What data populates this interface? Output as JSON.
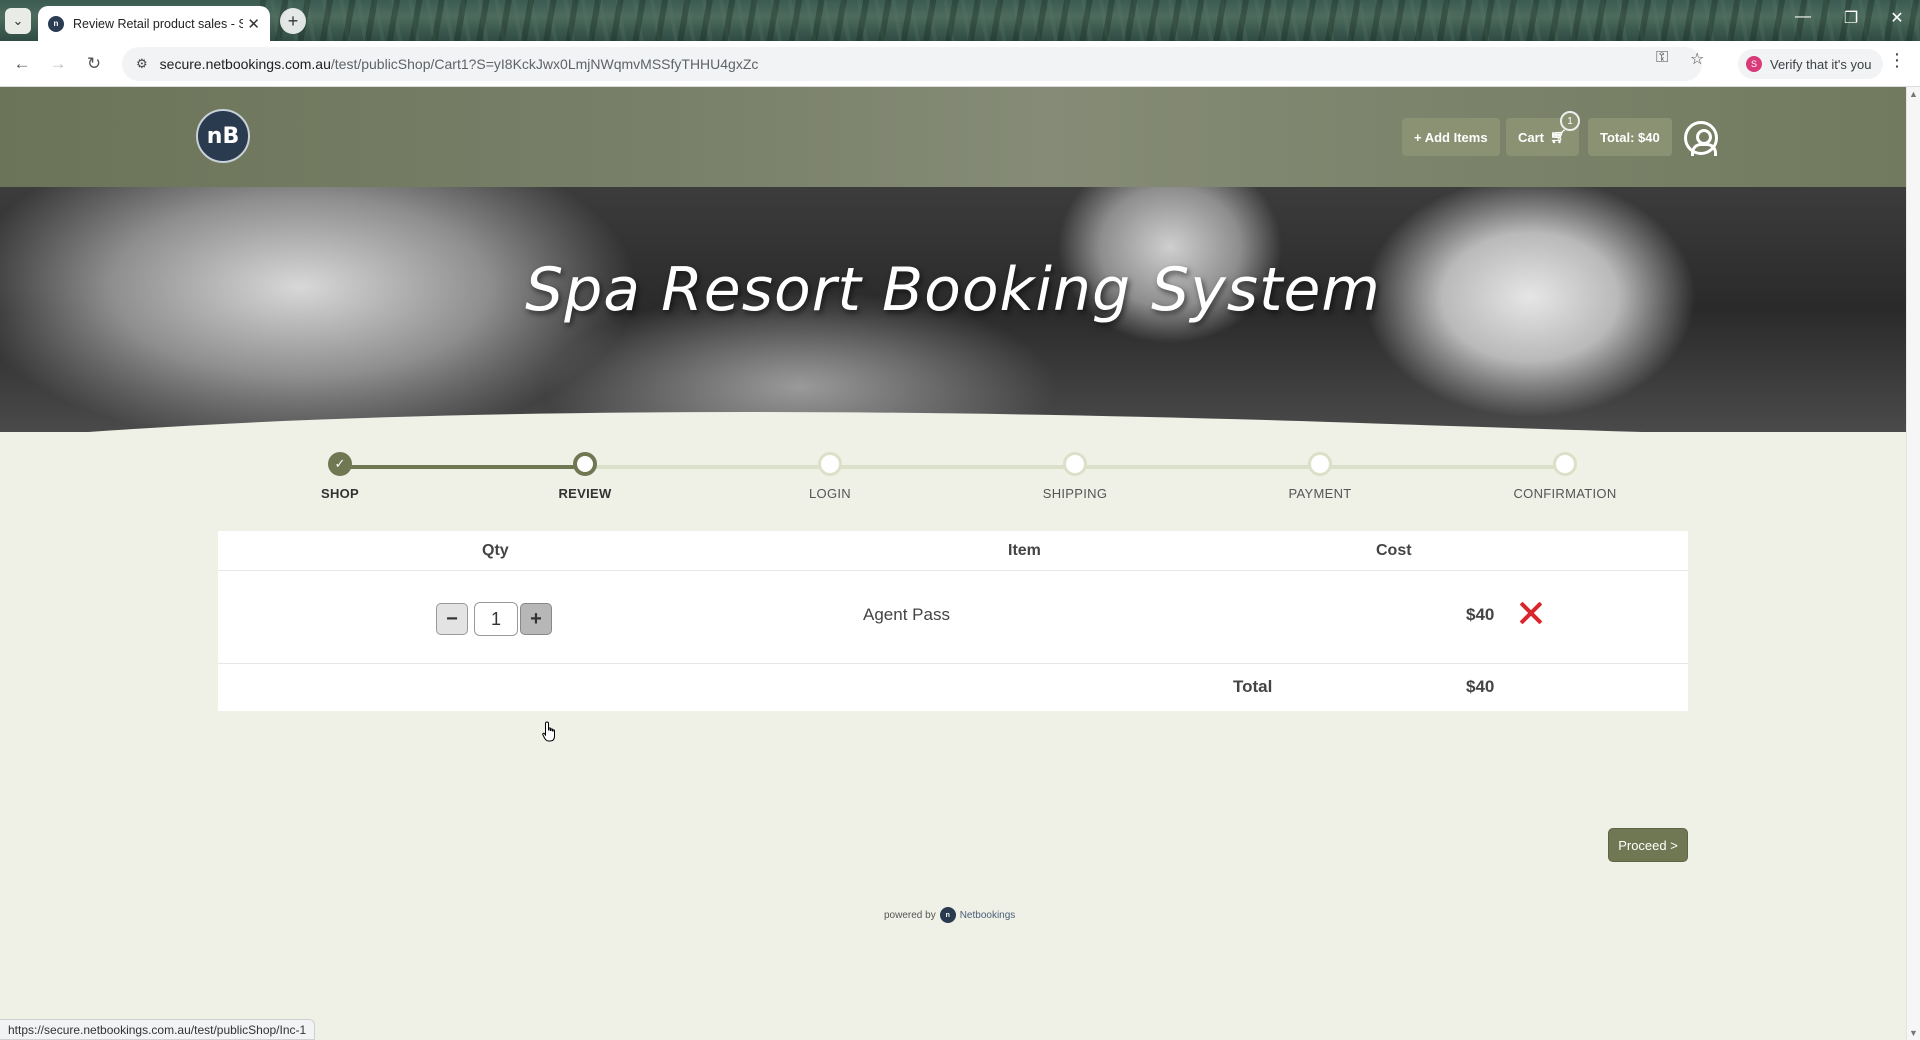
{
  "browser": {
    "tab_title": "Review Retail product sales - Sp",
    "url_host": "secure.netbookings.com.au",
    "url_path": "/test/publicShop/Cart1?S=yI8KckJwx0LmjNWqmvMSSfyTHHU4gxZc",
    "verify_label": "Verify that it's you",
    "status_url": "https://secure.netbookings.com.au/test/publicShop/Inc-1"
  },
  "header": {
    "logo_text": "nB",
    "add_items_label": "+ Add Items",
    "cart_label": "Cart",
    "cart_count": "1",
    "total_label": "Total: $40"
  },
  "hero": {
    "title": "Spa Resort Booking System"
  },
  "steps": [
    {
      "label": "SHOP",
      "state": "done"
    },
    {
      "label": "REVIEW",
      "state": "current"
    },
    {
      "label": "LOGIN",
      "state": "pending"
    },
    {
      "label": "SHIPPING",
      "state": "pending"
    },
    {
      "label": "PAYMENT",
      "state": "pending"
    },
    {
      "label": "CONFIRMATION",
      "state": "pending"
    }
  ],
  "cart": {
    "headers": {
      "qty": "Qty",
      "item": "Item",
      "cost": "Cost"
    },
    "rows": [
      {
        "qty": "1",
        "item": "Agent Pass",
        "cost": "$40"
      }
    ],
    "total_label": "Total",
    "total_value": "$40"
  },
  "actions": {
    "proceed_label": "Proceed >"
  },
  "footer": {
    "powered_by": "powered by",
    "brand": "Netbookings"
  },
  "colors": {
    "accent": "#6f7852",
    "remove": "#d9262c",
    "page_bg": "#eff1e6"
  }
}
